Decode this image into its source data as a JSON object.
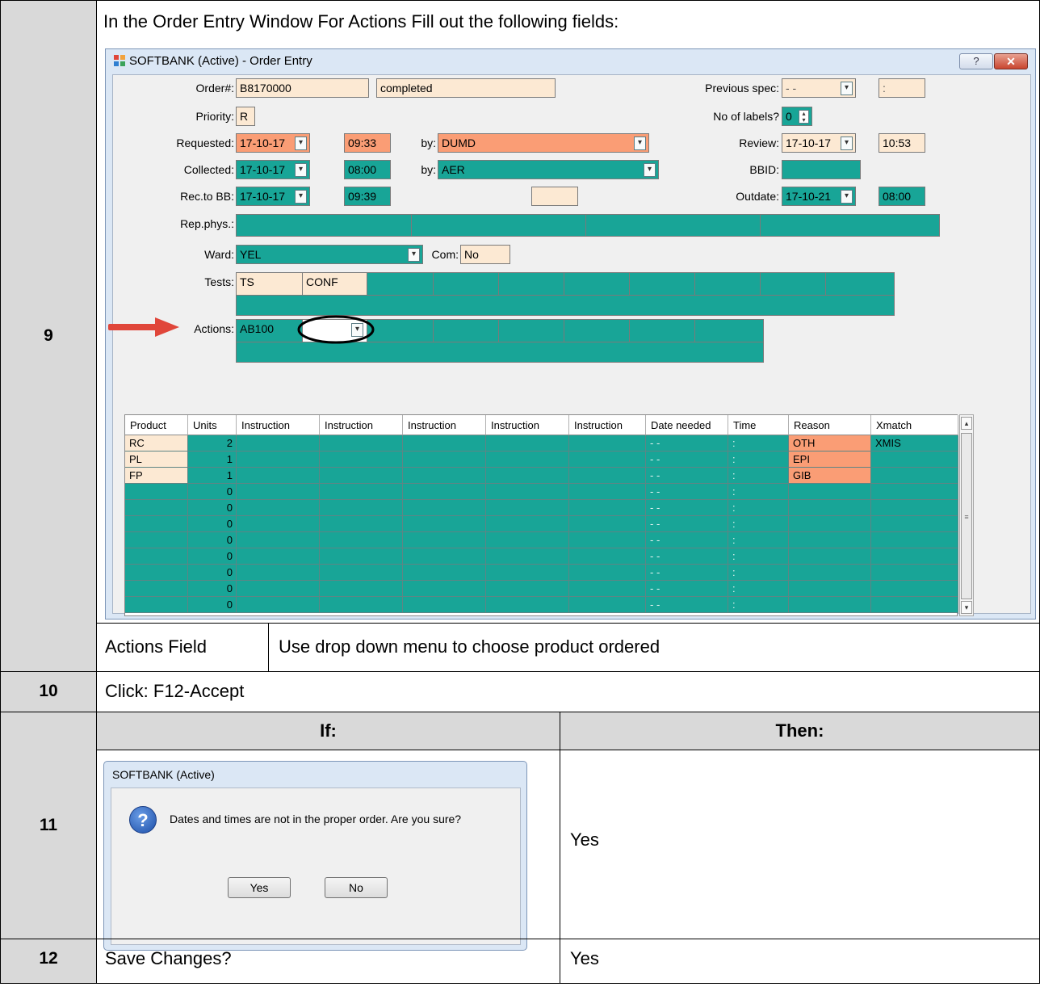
{
  "steps": {
    "s9": {
      "num": "9",
      "instruction": "In the Order Entry Window For Actions Fill out the following fields:",
      "field_name": "Actions Field",
      "field_desc": "Use drop down menu to choose product ordered"
    },
    "s10": {
      "num": "10",
      "instruction": "Click: F12-Accept"
    },
    "s11": {
      "num": "11",
      "if_header": "If:",
      "then_header": "Then:",
      "then_value": "Yes"
    },
    "s12": {
      "num": "12",
      "instruction": "Save Changes?",
      "then_value": "Yes"
    }
  },
  "window": {
    "title": "SOFTBANK (Active) - Order Entry",
    "help_label": "?",
    "close_label": "✕",
    "labels": {
      "order": "Order#:",
      "priority": "Priority:",
      "requested": "Requested:",
      "collected": "Collected:",
      "rec_to_bb": "Rec.to BB:",
      "rep_phys": "Rep.phys.:",
      "ward": "Ward:",
      "com": "Com:",
      "tests": "Tests:",
      "actions": "Actions:",
      "by": "by:",
      "previous_spec": "Previous spec:",
      "no_of_labels": "No of labels?",
      "review": "Review:",
      "bbid": "BBID:",
      "outdate": "Outdate:"
    },
    "values": {
      "order": "B8170000",
      "status": "completed",
      "priority": "R",
      "requested_date": "17-10-17",
      "requested_time": "09:33",
      "requested_by": "DUMD",
      "collected_date": "17-10-17",
      "collected_time": "08:00",
      "collected_by": "AER",
      "rec_date": "17-10-17",
      "rec_time": "09:39",
      "previous_spec": "- -",
      "previous_spec_time": ":",
      "no_of_labels": "0",
      "review_date": "17-10-17",
      "review_time": "10:53",
      "outdate_date": "17-10-21",
      "outdate_time": "08:00",
      "ward": "YEL",
      "com": "No",
      "test1": "TS",
      "test2": "CONF",
      "action1": "AB100"
    },
    "grid": {
      "headers": [
        "Product",
        "Units",
        "Instruction",
        "Instruction",
        "Instruction",
        "Instruction",
        "Instruction",
        "Date needed",
        "Time",
        "Reason",
        "Xmatch"
      ],
      "rows": [
        [
          "RC",
          "2",
          "",
          "",
          "",
          "",
          "",
          "- -",
          ":",
          "OTH",
          "XMIS"
        ],
        [
          "PL",
          "1",
          "",
          "",
          "",
          "",
          "",
          "- -",
          ":",
          "EPI",
          ""
        ],
        [
          "FP",
          "1",
          "",
          "",
          "",
          "",
          "",
          "- -",
          ":",
          "GIB",
          ""
        ],
        [
          "",
          "0",
          "",
          "",
          "",
          "",
          "",
          "- -",
          ":",
          "",
          ""
        ],
        [
          "",
          "0",
          "",
          "",
          "",
          "",
          "",
          "- -",
          ":",
          "",
          ""
        ],
        [
          "",
          "0",
          "",
          "",
          "",
          "",
          "",
          "- -",
          ":",
          "",
          ""
        ],
        [
          "",
          "0",
          "",
          "",
          "",
          "",
          "",
          "- -",
          ":",
          "",
          ""
        ],
        [
          "",
          "0",
          "",
          "",
          "",
          "",
          "",
          "- -",
          ":",
          "",
          ""
        ],
        [
          "",
          "0",
          "",
          "",
          "",
          "",
          "",
          "- -",
          ":",
          "",
          ""
        ],
        [
          "",
          "0",
          "",
          "",
          "",
          "",
          "",
          "- -",
          ":",
          "",
          ""
        ],
        [
          "",
          "0",
          "",
          "",
          "",
          "",
          "",
          "- -",
          ":",
          "",
          ""
        ]
      ]
    }
  },
  "dialog": {
    "title": "SOFTBANK (Active)",
    "message": "Dates and times are not in the proper order. Are you sure?",
    "yes": "Yes",
    "no": "No",
    "icon": "question-icon"
  },
  "colors": {
    "teal": "#18a597",
    "peach": "#fce9d3",
    "orange": "#fa9d75",
    "step_gray": "#d9d9d9",
    "arrow_red": "#e0463a"
  }
}
